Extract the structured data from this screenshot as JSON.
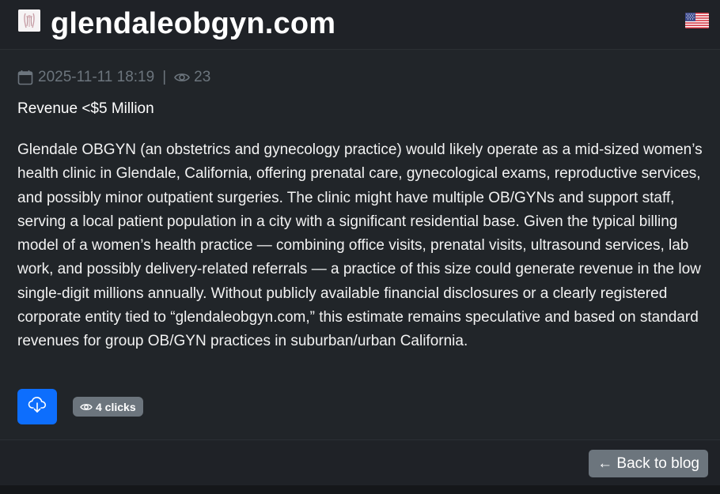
{
  "header": {
    "site_title": "glendaleobgyn.com",
    "logo_icon": "clinic-logo-icon",
    "flag_icon": "us-flag-icon"
  },
  "meta": {
    "date": "2025-11-11 18:19",
    "separator": "|",
    "views": "23",
    "calendar_icon": "calendar-icon",
    "eye_icon": "eye-icon"
  },
  "post": {
    "revenue": "Revenue <$5 Million",
    "description": "Glendale OBGYN (an obstetrics and gynecology practice) would likely operate as a mid-sized women’s health clinic in Glendale, California, offering prenatal care, gynecological exams, reproductive services, and possibly minor outpatient surgeries. The clinic might have multiple OB/GYNs and support staff, serving a local patient population in a city with a significant residential base. Given the typical billing model of a women’s health practice — combining office visits, prenatal visits, ultrasound services, lab work, and possibly delivery-related referrals — a practice of this size could generate revenue in the low single-digit millions annually. Without publicly available financial disclosures or a clearly registered corporate entity tied to “glendaleobgyn.com,” this estimate remains speculative and based on standard revenues for group OB/GYN practices in suburban/urban California."
  },
  "actions": {
    "download_icon": "cloud-download-icon",
    "clicks_label": "4 clicks",
    "back_label": "← Back to blog"
  },
  "colors": {
    "primary": "#0d6efd",
    "secondary": "#6c757d",
    "background": "#212529"
  }
}
